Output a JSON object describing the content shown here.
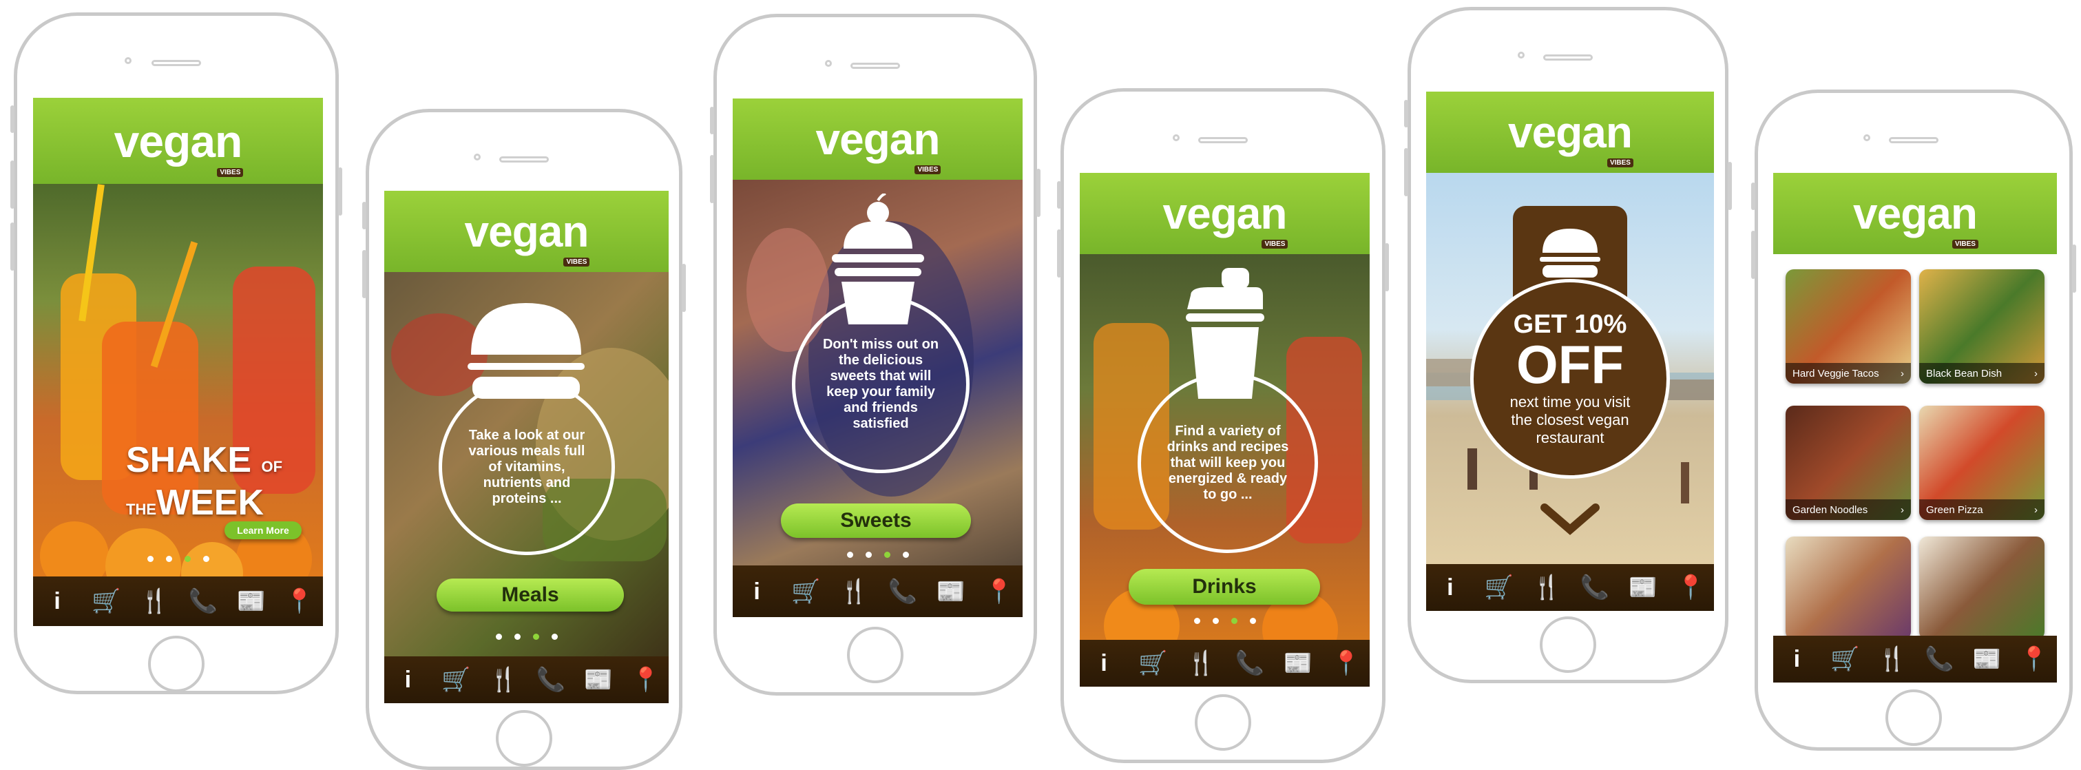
{
  "brand": {
    "logo": "vegan",
    "tagline": "VIBES",
    "green": "#8cc63f",
    "brown": "#4a2d10"
  },
  "nav_icons": [
    "info-icon",
    "cart-icon",
    "fork-knife-icon",
    "phone-icon",
    "news-icon",
    "location-pin-icon"
  ],
  "nav_glyphs": [
    "i",
    "🛒",
    "🍴",
    "📞",
    "📰",
    "📍"
  ],
  "screen1": {
    "line1": "SHAKE",
    "line_of": "OF",
    "line_the": "THE",
    "line2": "WEEK",
    "cta": "Learn More"
  },
  "screen2": {
    "text": "Take a look at our various meals full of vitamins, nutrients and proteins ...",
    "button": "Meals"
  },
  "screen3": {
    "text": "Don't miss out on the delicious sweets that will keep your family and friends satisfied",
    "button": "Sweets"
  },
  "screen4": {
    "text": "Find a variety of drinks and recipes that will keep you energized & ready to go ...",
    "button": "Drinks"
  },
  "screen5": {
    "promo_top": "GET 10%",
    "promo_big": "OFF",
    "promo_text": "next time you visit the closest vegan restaurant"
  },
  "screen6": {
    "items": [
      "Hard Veggie Tacos",
      "Black Bean Dish",
      "Garden Noodles",
      "Green Pizza",
      "",
      ""
    ]
  }
}
